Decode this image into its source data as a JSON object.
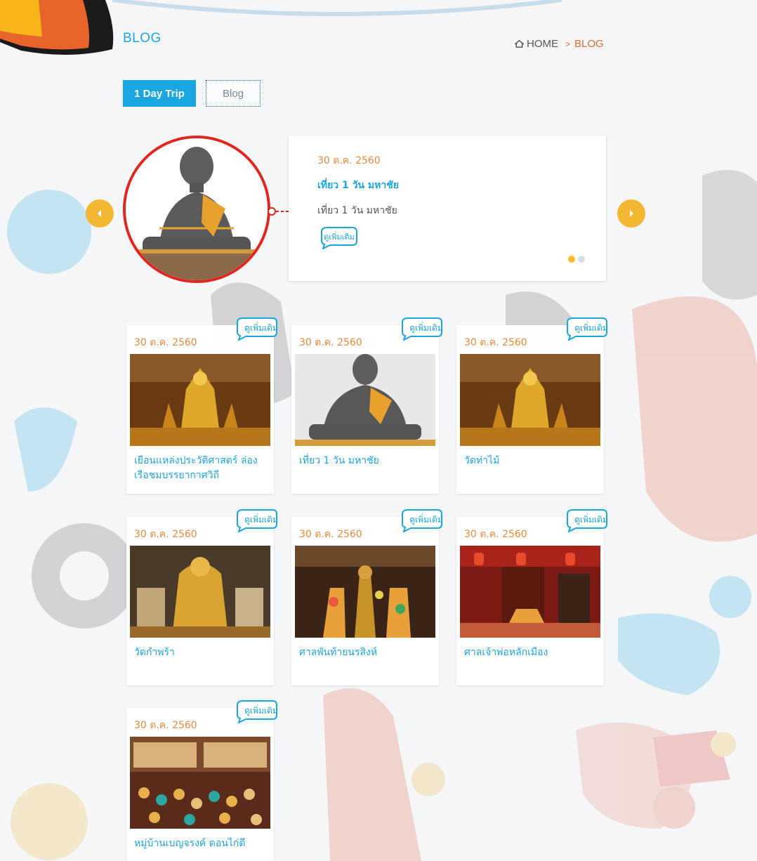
{
  "header": {
    "page_title": "BLOG",
    "breadcrumb": {
      "home": "HOME",
      "separator": ">",
      "current": "BLOG"
    }
  },
  "tabs": [
    {
      "label": "1 Day Trip",
      "active": true
    },
    {
      "label": "Blog",
      "active": false
    }
  ],
  "featured": {
    "date": "30 ต.ค. 2560",
    "title": "เที่ยว 1 วัน มหาชัย",
    "description": "เที่ยว 1 วัน มหาชัย",
    "more_label": "ดูเพิ่มเติม",
    "slides_total": 2,
    "slide_active": 1
  },
  "more_label": "ดูเพิ่มเติม",
  "posts": [
    {
      "date": "30 ต.ค. 2560",
      "title": "เยือนแหล่งประวัติศาสตร์ ล่องเรือชมบรรยากาศวิถี"
    },
    {
      "date": "30 ต.ค. 2560",
      "title": "เที่ยว 1 วัน มหาชัย"
    },
    {
      "date": "30 ต.ค. 2560",
      "title": "วัดท่าไม้"
    },
    {
      "date": "30 ต.ค. 2560",
      "title": "วัดกำพร้า"
    },
    {
      "date": "30 ต.ค. 2560",
      "title": "ศาลพันท้ายนรสิงห์"
    },
    {
      "date": "30 ต.ค. 2560",
      "title": "ศาลเจ้าพ่อหลักเมือง"
    },
    {
      "date": "30 ต.ค. 2560",
      "title": "หมู่บ้านเบญจรงค์ ดอนไก่ดี"
    }
  ],
  "colors": {
    "accent_blue": "#1aa6e0",
    "date_orange": "#e88a3a",
    "arrow_yellow": "#f3b731",
    "featured_ring_red": "#e0261d"
  }
}
